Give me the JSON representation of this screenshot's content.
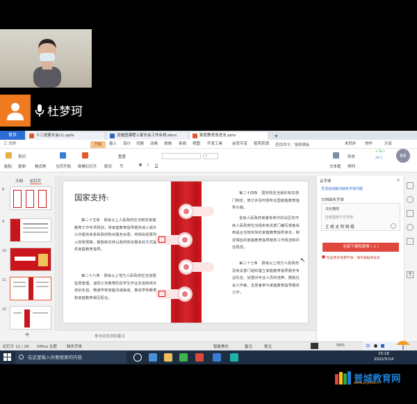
{
  "meeting": {
    "participant_name": "杜梦珂"
  },
  "tabs": {
    "home": "首页",
    "items": [
      {
        "label": "人二班家长会(1).pptx",
        "color": "#e25a2b"
      },
      {
        "label": "设施园课程上家长会工作业线.docx",
        "color": "#2f66c8"
      },
      {
        "label": "家庭教育促进法.pptx",
        "color": "#e25a2b"
      }
    ],
    "add": "+"
  },
  "menu": {
    "file": "三 文件",
    "items": [
      "开始",
      "插入",
      "设计",
      "切换",
      "动画",
      "放映",
      "审阅",
      "视图",
      "开发工具",
      "会员专享",
      "稻壳资源"
    ],
    "search_placeholder": "查找命令、搜索模板",
    "right": [
      "未同步",
      "协作",
      "分享"
    ]
  },
  "toolbar": {
    "paste": "粘贴",
    "cut": "剪切",
    "copy": "复制",
    "format_painter": "格式刷",
    "from_current": "当页开始",
    "new_slide": "新建幻灯片",
    "layout": "版式",
    "section": "节",
    "reset": "重置",
    "font_value": "",
    "size_value": "0",
    "text_box": "文本框",
    "arrange": "排列",
    "shape": "形状",
    "speed": "+78.1",
    "speed_down": "26.1",
    "cpu": "84"
  },
  "left_panel": {
    "tab_outline": "大纲",
    "tab_slides": "幻灯片",
    "slide_numbers": [
      "8",
      "9",
      "10",
      "11",
      "12"
    ]
  },
  "slide": {
    "title": "国家支持:",
    "left_paragraphs": [
      "第二十五条　县级以上人民政府应当制定家庭教育工作专项规划，将家庭教育指导服务纳入城乡公共服务体系和政府购买服务目录，将相关经费列入财政预算，鼓励和支持以政府购买服务的方式提供家庭教育指导。",
      "第二十六条　县级以上地方人民政府应当加强监督管理，减轻义务教育阶段学生作业负担和校外培训负担，畅通学校家庭沟通渠道，推进学校教育和家庭教育相互配合。"
    ],
    "right_paragraphs": [
      "第二十四条　国务院应当组织有关部门制定、修订并及时颁布全国家庭教育指导大纲。",
      "省级人民政府或者有条件的设区的市级人民政府应当组织有关部门编写或者采用适合当地实际的家庭教育指导读本，制定相应的家庭教育指导服务工作规范和评估规范。",
      "第二十七条　县级以上地方人民政府及有关部门组织建立家庭教育指导服务专业队伍，加强对专业人员的培养，鼓励社会工作者、志愿者参与家庭教育指导服务工作。"
    ]
  },
  "notes": {
    "placeholder": "单击此处添加备注"
  },
  "right_panel": {
    "title": "云字体",
    "link": "灵活自动解决缺失字体问题",
    "label": "文档缺失字体",
    "line1": "汉仪楷体",
    "line2": "应用选用下方字体",
    "line3": "王 框 支 阿 翔 粗",
    "button": "全部下载和替换 ( 1 )",
    "note": "包含更多免费字体、请开通稻壳会员"
  },
  "status_bar": {
    "slide_counter": "幻灯片 11 / 26",
    "theme": "Office 主题",
    "missing_fonts": "缺失字体",
    "smart_beautify": "智能美化",
    "notes_btn": "备注",
    "comments": "批注",
    "zoom": "58%"
  },
  "taskbar": {
    "search_placeholder": "在这里输入你要搜索的内容",
    "time": "15:18",
    "date": "2022/5/14",
    "ime_label": "中"
  },
  "watermark": {
    "brand": "普城教育网",
    "url": "www.pcjyedu.cn"
  }
}
